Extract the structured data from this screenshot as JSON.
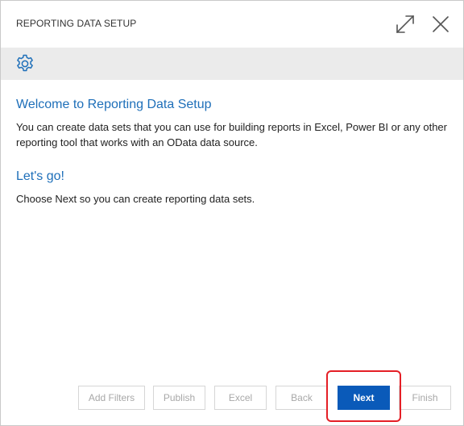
{
  "dialog": {
    "title": "REPORTING DATA SETUP",
    "expand_icon": "expand-icon",
    "close_icon": "close-icon"
  },
  "toolbar": {
    "settings_icon": "gear-icon"
  },
  "content": {
    "welcome_heading": "Welcome to Reporting Data Setup",
    "welcome_text": "You can create data sets that you can use for building reports in Excel, Power BI or any other reporting tool that works with an OData data source.",
    "letsgo_heading": "Let's go!",
    "letsgo_text": "Choose Next so you can create reporting data sets."
  },
  "footer": {
    "add_filters_label": "Add Filters",
    "publish_label": "Publish",
    "excel_label": "Excel",
    "back_label": "Back",
    "next_label": "Next",
    "finish_label": "Finish"
  },
  "colors": {
    "accent": "#0a5ab9",
    "heading": "#1e6fb9",
    "toolbar_bg": "#ebebeb",
    "highlight": "#e41f26"
  }
}
